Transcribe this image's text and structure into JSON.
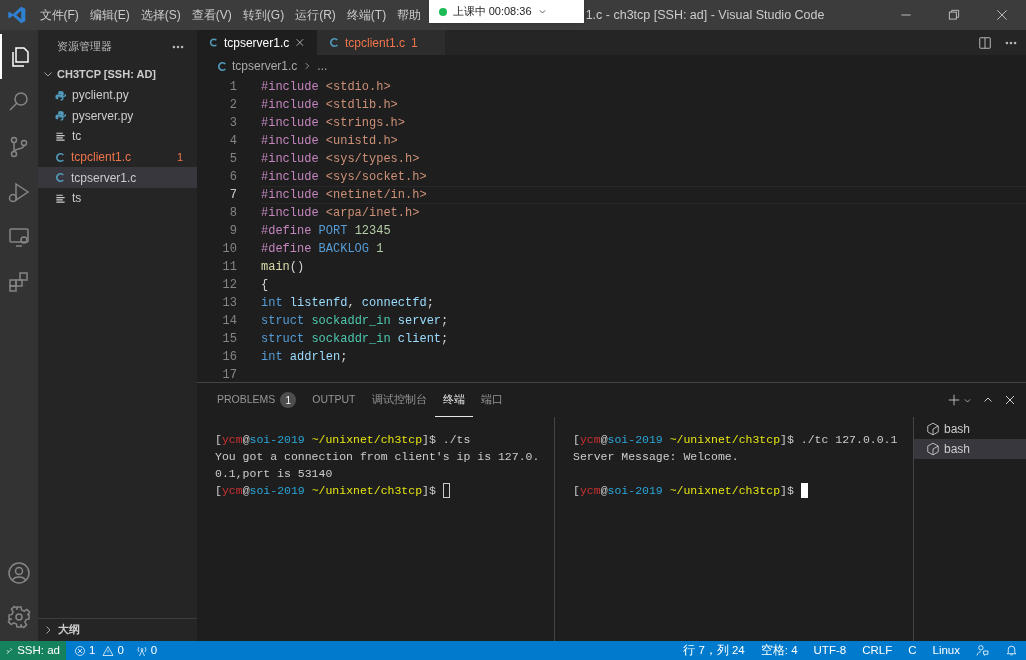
{
  "menu": [
    "文件(F)",
    "编辑(E)",
    "选择(S)",
    "查看(V)",
    "转到(G)",
    "运行(R)",
    "终端(T)",
    "帮助"
  ],
  "recording_badge": {
    "text": "上课中 00:08:36"
  },
  "window": {
    "title": "1.c - ch3tcp [SSH: ad] - Visual Studio Code"
  },
  "activity_bar": [
    {
      "kind": "files",
      "selected": true
    },
    {
      "kind": "search",
      "selected": false
    },
    {
      "kind": "source-control",
      "selected": false
    },
    {
      "kind": "run",
      "selected": false
    },
    {
      "kind": "remote",
      "selected": false
    },
    {
      "kind": "extensions",
      "selected": false
    }
  ],
  "sidebar": {
    "title": "资源管理器",
    "folder": "CH3TCP [SSH: AD]",
    "expanded": true,
    "items": [
      {
        "kind": "python",
        "name": "pyclient.py",
        "error": false,
        "selected": false
      },
      {
        "kind": "python",
        "name": "pyserver.py",
        "error": false,
        "selected": false
      },
      {
        "kind": "text",
        "name": "tc",
        "error": false,
        "selected": false
      },
      {
        "kind": "c",
        "name": "tcpclient1.c",
        "error": true,
        "badge": "1",
        "selected": false
      },
      {
        "kind": "c",
        "name": "tcpserver1.c",
        "error": false,
        "selected": true
      },
      {
        "kind": "text",
        "name": "ts",
        "error": false,
        "selected": false
      }
    ],
    "outline": "大纲"
  },
  "tabs": [
    {
      "label": "tcpserver1.c",
      "selected": true,
      "error": false
    },
    {
      "label": "tcpclient1.c",
      "selected": false,
      "error": true,
      "badge": "1"
    }
  ],
  "breadcrumb": [
    "tcpserver1.c",
    "..."
  ],
  "editor": {
    "lines": [
      {
        "n": "1",
        "current": false,
        "tokens": [
          {
            "t": "#include ",
            "kind": "keyword"
          },
          {
            "t": "<stdio.h>",
            "kind": "string"
          }
        ]
      },
      {
        "n": "2",
        "current": false,
        "tokens": [
          {
            "t": "#include ",
            "kind": "keyword"
          },
          {
            "t": "<stdlib.h>",
            "kind": "string"
          }
        ]
      },
      {
        "n": "3",
        "current": false,
        "tokens": [
          {
            "t": "#include ",
            "kind": "keyword"
          },
          {
            "t": "<strings.h>",
            "kind": "string"
          }
        ]
      },
      {
        "n": "4",
        "current": false,
        "tokens": [
          {
            "t": "#include ",
            "kind": "keyword"
          },
          {
            "t": "<unistd.h>",
            "kind": "string"
          }
        ]
      },
      {
        "n": "5",
        "current": false,
        "tokens": [
          {
            "t": "#include ",
            "kind": "keyword"
          },
          {
            "t": "<sys/types.h>",
            "kind": "string"
          }
        ]
      },
      {
        "n": "6",
        "current": false,
        "tokens": [
          {
            "t": "#include ",
            "kind": "keyword"
          },
          {
            "t": "<sys/socket.h>",
            "kind": "string"
          }
        ]
      },
      {
        "n": "7",
        "current": true,
        "tokens": [
          {
            "t": "#include ",
            "kind": "keyword"
          },
          {
            "t": "<netinet/in.h>",
            "kind": "string"
          }
        ]
      },
      {
        "n": "8",
        "current": false,
        "tokens": [
          {
            "t": "#include ",
            "kind": "keyword"
          },
          {
            "t": "<arpa/inet.h>",
            "kind": "string"
          }
        ]
      },
      {
        "n": "9",
        "current": false,
        "tokens": [
          {
            "t": "#define ",
            "kind": "keyword"
          },
          {
            "t": "PORT ",
            "kind": "macro"
          },
          {
            "t": "12345",
            "kind": "number"
          }
        ]
      },
      {
        "n": "10",
        "current": false,
        "tokens": [
          {
            "t": "#define ",
            "kind": "keyword"
          },
          {
            "t": "BACKLOG ",
            "kind": "macro"
          },
          {
            "t": "1",
            "kind": "number"
          }
        ]
      },
      {
        "n": "11",
        "current": false,
        "tokens": [
          {
            "t": "main",
            "kind": "function"
          },
          {
            "t": "()",
            "kind": "plain"
          }
        ]
      },
      {
        "n": "12",
        "current": false,
        "tokens": [
          {
            "t": "{",
            "kind": "plain"
          }
        ]
      },
      {
        "n": "13",
        "current": false,
        "tokens": [
          {
            "t": "int ",
            "kind": "macro"
          },
          {
            "t": "listenfd",
            "kind": "variable"
          },
          {
            "t": ", ",
            "kind": "plain"
          },
          {
            "t": "connectfd",
            "kind": "variable"
          },
          {
            "t": ";",
            "kind": "plain"
          }
        ]
      },
      {
        "n": "14",
        "current": false,
        "tokens": [
          {
            "t": "struct ",
            "kind": "macro"
          },
          {
            "t": "sockaddr_in ",
            "kind": "type"
          },
          {
            "t": "server",
            "kind": "variable"
          },
          {
            "t": ";",
            "kind": "plain"
          }
        ]
      },
      {
        "n": "15",
        "current": false,
        "tokens": [
          {
            "t": "struct ",
            "kind": "macro"
          },
          {
            "t": "sockaddr_in ",
            "kind": "type"
          },
          {
            "t": "client",
            "kind": "variable"
          },
          {
            "t": ";",
            "kind": "plain"
          }
        ]
      },
      {
        "n": "16",
        "current": false,
        "tokens": [
          {
            "t": "int ",
            "kind": "macro"
          },
          {
            "t": "addrlen",
            "kind": "variable"
          },
          {
            "t": ";",
            "kind": "plain"
          }
        ]
      },
      {
        "n": "17",
        "current": false
      }
    ]
  },
  "panel": {
    "tabs": [
      {
        "label": "PROBLEMS",
        "badge": "1",
        "selected": false
      },
      {
        "label": "OUTPUT",
        "selected": false
      },
      {
        "label": "调试控制台",
        "selected": false
      },
      {
        "label": "终端",
        "selected": true
      },
      {
        "label": "端口",
        "selected": false
      }
    ],
    "terminals": [
      {
        "cursor_filled": false,
        "lines": [
          {
            "blank_before": false,
            "segments": [
              {
                "t": "[",
                "kind": "plain"
              },
              {
                "t": "ycm",
                "kind": "user"
              },
              {
                "t": "@",
                "kind": "plain"
              },
              {
                "t": "soi-2019",
                "kind": "host"
              },
              {
                "t": " ~/unixnet/ch3tcp",
                "kind": "path"
              },
              {
                "t": "]$ ./ts",
                "kind": "plain"
              }
            ]
          },
          {
            "blank_before": false,
            "segments": [
              {
                "t": "You got a connection from client's ip is 127.0.",
                "kind": "plain"
              }
            ]
          },
          {
            "blank_before": false,
            "segments": [
              {
                "t": "0.1,port is 53140",
                "kind": "plain"
              }
            ]
          },
          {
            "blank_before": false,
            "segments": [
              {
                "t": "[",
                "kind": "plain"
              },
              {
                "t": "ycm",
                "kind": "user"
              },
              {
                "t": "@",
                "kind": "plain"
              },
              {
                "t": "soi-2019",
                "kind": "host"
              },
              {
                "t": " ~/unixnet/ch3tcp",
                "kind": "path"
              },
              {
                "t": "]$",
                "kind": "plain"
              }
            ]
          }
        ]
      },
      {
        "cursor_filled": true,
        "lines": [
          {
            "blank_before": false,
            "segments": [
              {
                "t": "[",
                "kind": "plain"
              },
              {
                "t": "ycm",
                "kind": "user"
              },
              {
                "t": "@",
                "kind": "plain"
              },
              {
                "t": "soi-2019",
                "kind": "host"
              },
              {
                "t": " ~/unixnet/ch3tcp",
                "kind": "path"
              },
              {
                "t": "]$ ./tc 127.0.0.1",
                "kind": "plain"
              }
            ]
          },
          {
            "blank_before": false,
            "segments": [
              {
                "t": "Server Message: Welcome.",
                "kind": "plain"
              }
            ]
          },
          {
            "blank_before": true,
            "segments": [
              {
                "t": "[",
                "kind": "plain"
              },
              {
                "t": "ycm",
                "kind": "user"
              },
              {
                "t": "@",
                "kind": "plain"
              },
              {
                "t": "soi-2019",
                "kind": "host"
              },
              {
                "t": " ~/unixnet/ch3tcp",
                "kind": "path"
              },
              {
                "t": "]$",
                "kind": "plain"
              }
            ]
          }
        ]
      }
    ],
    "terminal_list": [
      {
        "label": "bash",
        "selected": false
      },
      {
        "label": "bash",
        "selected": true
      }
    ]
  },
  "status_bar": {
    "remote": "SSH: ad",
    "errors": "1",
    "warnings": "0",
    "ports": "0",
    "right": [
      "行 7，列 24",
      "空格: 4",
      "UTF-8",
      "CRLF",
      "C",
      "Linux"
    ]
  }
}
